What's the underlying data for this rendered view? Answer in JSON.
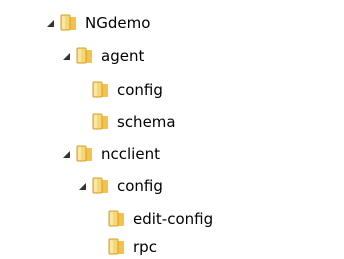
{
  "tree": {
    "items": [
      {
        "label": "NGdemo",
        "expanded": true,
        "icon": "folder-icon"
      },
      {
        "label": "agent",
        "expanded": true,
        "icon": "folder-icon"
      },
      {
        "label": "config",
        "expanded": false,
        "icon": "folder-icon"
      },
      {
        "label": "schema",
        "expanded": false,
        "icon": "folder-icon"
      },
      {
        "label": "ncclient",
        "expanded": true,
        "icon": "folder-icon"
      },
      {
        "label": "config",
        "expanded": true,
        "icon": "folder-icon"
      },
      {
        "label": "edit-config",
        "expanded": false,
        "icon": "folder-icon"
      },
      {
        "label": "rpc",
        "expanded": false,
        "icon": "folder-icon"
      }
    ]
  }
}
